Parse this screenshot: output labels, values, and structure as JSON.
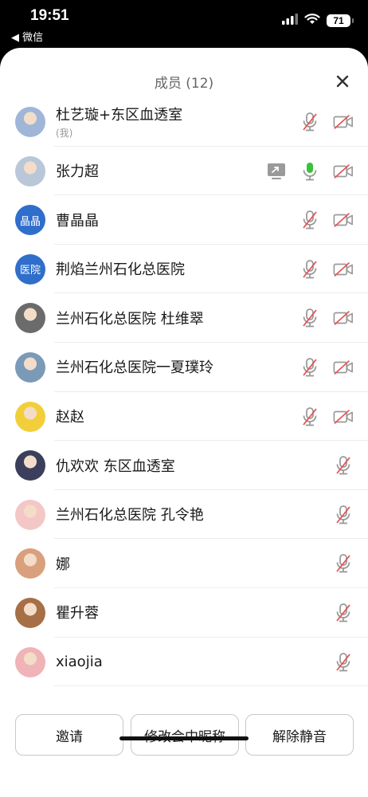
{
  "status_bar": {
    "time": "19:51",
    "back_app": "◀ 微信",
    "battery": "71"
  },
  "sheet": {
    "title": "成员 (12)"
  },
  "members": [
    {
      "name": "杜艺璇+东区血透室",
      "sub": "(我)",
      "avatar": "photo",
      "avatar_color": "#9fb6d9",
      "screen_share": false,
      "mic": "muted",
      "camera": "off"
    },
    {
      "name": "张力超",
      "sub": "",
      "avatar": "photo",
      "avatar_color": "#b9c7d8",
      "screen_share": true,
      "mic": "active",
      "camera": "off"
    },
    {
      "name": "曹晶晶",
      "sub": "",
      "avatar": "text",
      "avatar_text": "晶晶",
      "screen_share": false,
      "mic": "muted",
      "camera": "off"
    },
    {
      "name": "荆焰兰州石化总医院",
      "sub": "",
      "avatar": "text",
      "avatar_text": "医院",
      "screen_share": false,
      "mic": "muted",
      "camera": "off"
    },
    {
      "name": "兰州石化总医院 杜维翠",
      "sub": "",
      "avatar": "photo",
      "avatar_color": "#6b6b6b",
      "screen_share": false,
      "mic": "muted",
      "camera": "off"
    },
    {
      "name": "兰州石化总医院一夏璞玲",
      "sub": "",
      "avatar": "photo",
      "avatar_color": "#7a9ab8",
      "screen_share": false,
      "mic": "muted",
      "camera": "off"
    },
    {
      "name": "赵赵",
      "sub": "",
      "avatar": "photo",
      "avatar_color": "#f2cf3a",
      "screen_share": false,
      "mic": "muted",
      "camera": "off"
    },
    {
      "name": "仇欢欢   东区血透室",
      "sub": "",
      "avatar": "photo",
      "avatar_color": "#3b3f5c",
      "screen_share": false,
      "mic": "muted",
      "camera": "none"
    },
    {
      "name": "兰州石化总医院 孔令艳",
      "sub": "",
      "avatar": "photo",
      "avatar_color": "#f4c7c7",
      "screen_share": false,
      "mic": "muted",
      "camera": "none"
    },
    {
      "name": "娜",
      "sub": "",
      "avatar": "photo",
      "avatar_color": "#d9a07e",
      "screen_share": false,
      "mic": "muted",
      "camera": "none"
    },
    {
      "name": "瞿升蓉",
      "sub": "",
      "avatar": "photo",
      "avatar_color": "#a66f45",
      "screen_share": false,
      "mic": "muted",
      "camera": "none"
    },
    {
      "name": "xiaojia",
      "sub": "",
      "avatar": "photo",
      "avatar_color": "#f0b3b8",
      "screen_share": false,
      "mic": "muted",
      "camera": "none"
    }
  ],
  "actions": {
    "invite": "邀请",
    "rename": "修改会中昵称",
    "unmute": "解除静音"
  },
  "colors": {
    "accent_blue": "#2f6ecb",
    "mic_active": "#3cc13b",
    "muted_red": "#e55353",
    "icon_gray": "#9a9a9a"
  }
}
